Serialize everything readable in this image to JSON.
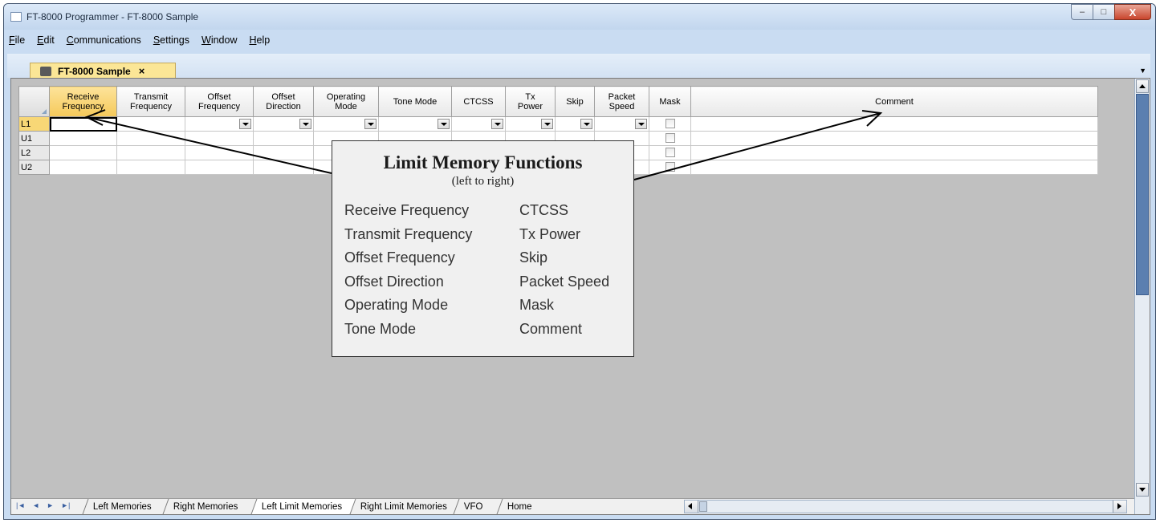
{
  "window": {
    "title": "FT-8000 Programmer - FT-8000 Sample",
    "buttons": {
      "minimize": "–",
      "maximize": "□",
      "close": "X"
    }
  },
  "menu": [
    {
      "label": "File",
      "accel": "F",
      "rest": "ile"
    },
    {
      "label": "Edit",
      "accel": "E",
      "rest": "dit"
    },
    {
      "label": "Communications",
      "accel": "C",
      "rest": "ommunications"
    },
    {
      "label": "Settings",
      "accel": "S",
      "rest": "ettings"
    },
    {
      "label": "Window",
      "accel": "W",
      "rest": "indow"
    },
    {
      "label": "Help",
      "accel": "H",
      "rest": "elp"
    }
  ],
  "document_tab": {
    "label": "FT-8000 Sample",
    "close": "×",
    "dropdown": "▼"
  },
  "grid": {
    "columns": [
      {
        "line1": "Receive",
        "line2": "Frequency"
      },
      {
        "line1": "Transmit",
        "line2": "Frequency"
      },
      {
        "line1": "Offset",
        "line2": "Frequency"
      },
      {
        "line1": "Offset",
        "line2": "Direction"
      },
      {
        "line1": "Operating",
        "line2": "Mode"
      },
      {
        "line1": "Tone Mode",
        "line2": ""
      },
      {
        "line1": "CTCSS",
        "line2": ""
      },
      {
        "line1": "Tx",
        "line2": "Power"
      },
      {
        "line1": "Skip",
        "line2": ""
      },
      {
        "line1": "Packet",
        "line2": "Speed"
      },
      {
        "line1": "Mask",
        "line2": ""
      },
      {
        "line1": "Comment",
        "line2": ""
      }
    ],
    "rows": [
      "L1",
      "U1",
      "L2",
      "U2"
    ]
  },
  "callout": {
    "title": "Limit Memory Functions",
    "subtitle": "(left to right)",
    "left": [
      "Receive Frequency",
      "Transmit Frequency",
      "Offset Frequency",
      "Offset Direction",
      "Operating Mode",
      "Tone Mode"
    ],
    "right": [
      "CTCSS",
      "Tx Power",
      "Skip",
      "Packet Speed",
      "Mask",
      "Comment"
    ]
  },
  "sheet_nav": {
    "first": "|◄",
    "prev": "◄",
    "next": "►",
    "last": "►|"
  },
  "sheet_tabs": [
    "Left Memories",
    "Right Memories",
    "Left Limit Memories",
    "Right Limit Memories",
    "VFO",
    "Home"
  ],
  "active_sheet_tab": "Left Limit Memories",
  "colors": {
    "accent_tab": "#fbe696",
    "scroll_thumb": "#5b7fb0",
    "grid_bg": "#c0c0c0"
  }
}
